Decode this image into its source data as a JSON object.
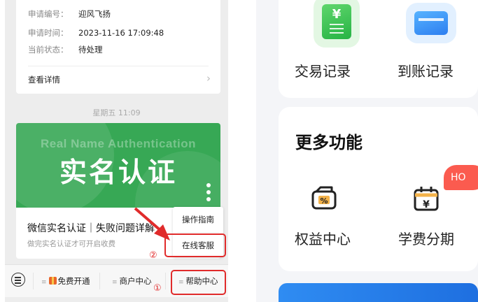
{
  "chat": {
    "info_rows": [
      {
        "key": "申请编号：",
        "value": "迎风飞扬"
      },
      {
        "key": "申请时间：",
        "value": "2023-11-16 17:09:48"
      },
      {
        "key": "当前状态：",
        "value": "待处理"
      }
    ],
    "detail_link": "查看详情",
    "timestamp": "星期五 11:09",
    "article": {
      "banner_en": "Real Name Authentication",
      "banner_cn": "实名认证",
      "title": "微信实名认证｜失败问题详解",
      "subtitle": "做完实名认证才可开启收费"
    },
    "popup": [
      "操作指南",
      "在线客服"
    ],
    "markers": [
      "①",
      "②"
    ],
    "menu": [
      "免费开通",
      "商户中心",
      "帮助中心"
    ],
    "colors": {
      "highlight": "#e02b2b",
      "banner": "#37a855"
    }
  },
  "app": {
    "top_items": [
      {
        "label": "交易记录",
        "icon": "transaction-record-icon"
      },
      {
        "label": "到账记录",
        "icon": "card-icon"
      }
    ],
    "section_title": "更多功能",
    "hot_badge": "HO",
    "more_items": [
      {
        "label": "权益中心",
        "icon": "coupon-icon"
      },
      {
        "label": "学费分期",
        "icon": "calendar-yuan-icon"
      }
    ]
  }
}
